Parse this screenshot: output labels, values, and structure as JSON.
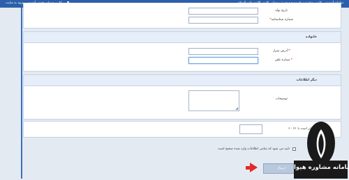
{
  "topbar": {
    "breadcrumb": "سامانه آموزشی کانون --> ثبت نام دوره دوم شیرودوانی کانون الائمه علیه السلام",
    "welcome": "کاربر مهمان، خوش آمدید",
    "login": "ورود به سایت",
    "login_arrow": "▼"
  },
  "personal": {
    "birth_date_label": "تاریخ تولد",
    "id_number_label": "شماره شناسنامه",
    "id_number_required": "*"
  },
  "contact": {
    "title": "خانواده",
    "home_address_label": "آدرس منزل",
    "phone_label": "شماره تلفن",
    "required": "*"
  },
  "extra": {
    "title": "دیگر اطلاعات",
    "notes_label": "توضیحات"
  },
  "captcha": {
    "question": "۶ - ۲۱ برابر است با"
  },
  "confirm": {
    "label": "تایید می شود که تمامی اطلاعات وارد شده صحیح است"
  },
  "submit": {
    "label": "ارسال"
  },
  "logo": {
    "text": "سامانه مشاوره هیوا"
  },
  "colors": {
    "topbar": "#2b5fab",
    "section_header": "#e6eef9",
    "required": "#cc0000",
    "arrow": "#e12a2a",
    "logo": "#1a1a1a"
  }
}
